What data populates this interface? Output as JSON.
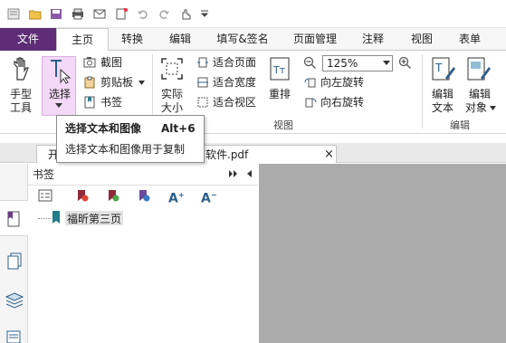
{
  "tabs": [
    "文件",
    "主页",
    "转换",
    "编辑",
    "填写&签名",
    "页面管理",
    "注释",
    "视图",
    "表单"
  ],
  "ribbon": {
    "hand_label": "手型",
    "hand_label2": "工具",
    "select_label": "选择",
    "screenshot_label": "截图",
    "clipboard_label": "剪贴板",
    "bookmark_label": "书签",
    "actual_size_label": "实际",
    "actual_size_label2": "大小",
    "fit_page_label": "适合页面",
    "fit_width_label": "适合宽度",
    "fit_view_label": "适合视区",
    "reflow_label": "重排",
    "zoom_value": "125%",
    "rotate_left_label": "向左旋转",
    "rotate_right_label": "向右旋转",
    "view_group_label": "视图",
    "edit_text_label": "编辑",
    "edit_text_label2": "文本",
    "edit_object_label": "编辑",
    "edit_object_label2": "对象",
    "edit_group_label": "编辑"
  },
  "tooltip": {
    "title": "选择文本和图像",
    "shortcut": "Alt+6",
    "desc": "选择文本和图像用于复制"
  },
  "doc_tabs": {
    "tab1_partial": "开",
    "tab2_label": "软件.pdf",
    "close": "×"
  },
  "bookmarks_panel": {
    "title": "书签",
    "item": "福昕第三页"
  },
  "colors": {
    "file_tab": "#5f2d77",
    "selected_tool": "#f3d8f7",
    "viewer_bg": "#ababab"
  }
}
